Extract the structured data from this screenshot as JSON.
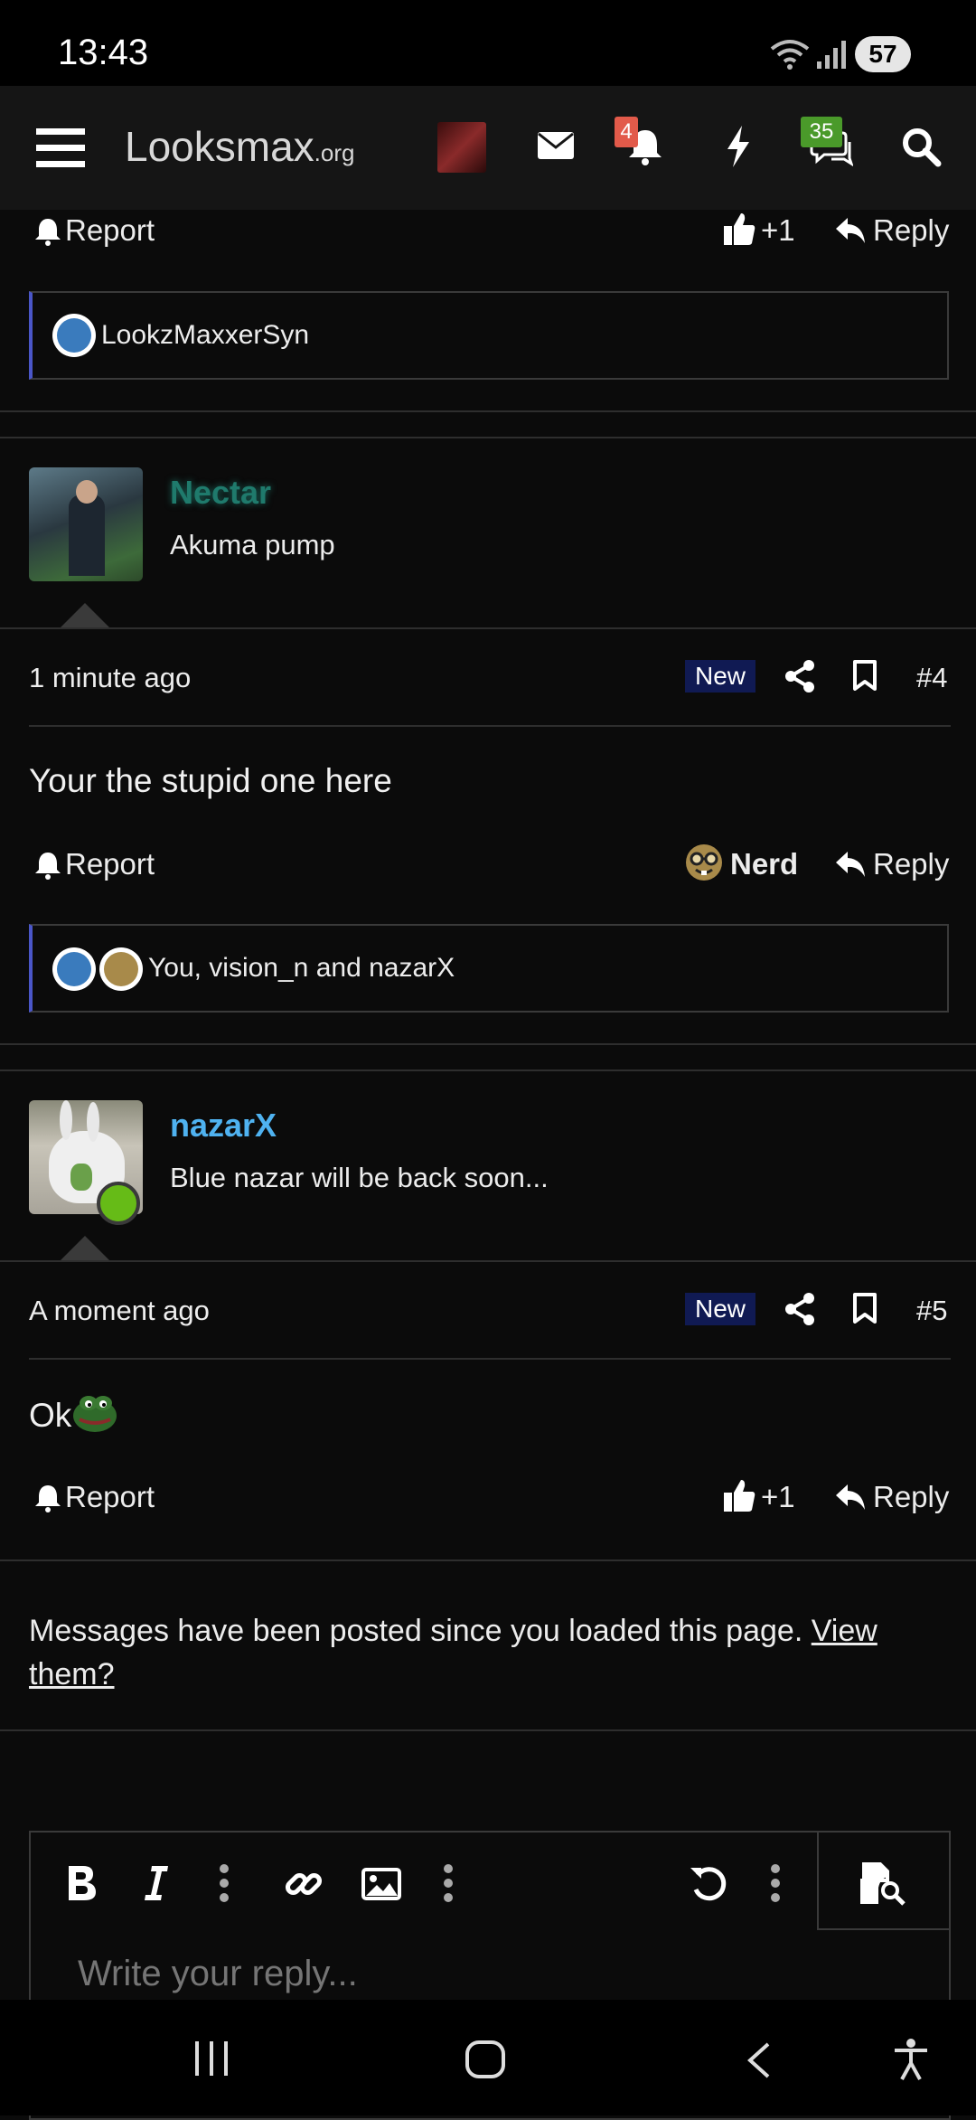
{
  "status_bar": {
    "time": "13:43",
    "battery": "57"
  },
  "nav": {
    "logo_text": "Looksmax",
    "logo_suffix": ".org",
    "alerts_badge": "4",
    "conversations_badge": "35"
  },
  "post3": {
    "report_label": "Report",
    "like_count": "+1",
    "reply_label": "Reply",
    "reactions_text": "LookzMaxxerSyn"
  },
  "post4": {
    "username": "Nectar",
    "user_title": "Akuma pump",
    "time": "1 minute ago",
    "new_badge": "New",
    "post_number": "#4",
    "content": "Your the stupid one here",
    "report_label": "Report",
    "reaction_label": "Nerd",
    "reply_label": "Reply",
    "reactions_text": "You, vision_n and nazarX"
  },
  "post5": {
    "username": "nazarX",
    "user_title": "Blue nazar will be back soon...",
    "time": "A moment ago",
    "new_badge": "New",
    "post_number": "#5",
    "content": "Ok",
    "report_label": "Report",
    "like_count": "+1",
    "reply_label": "Reply"
  },
  "notice": {
    "text": "Messages have been posted since you loaded this page. ",
    "link": "View them?"
  },
  "editor": {
    "placeholder": "Write your reply..."
  },
  "colors": {
    "nectar_name": "#1f7a6c",
    "nazarx_name": "#4fb2f0",
    "online_dot": "#66bb17",
    "alerts_badge_bg": "#e25a4a",
    "conversations_badge_bg": "#4a9a2a",
    "new_badge_bg": "#101a53"
  }
}
